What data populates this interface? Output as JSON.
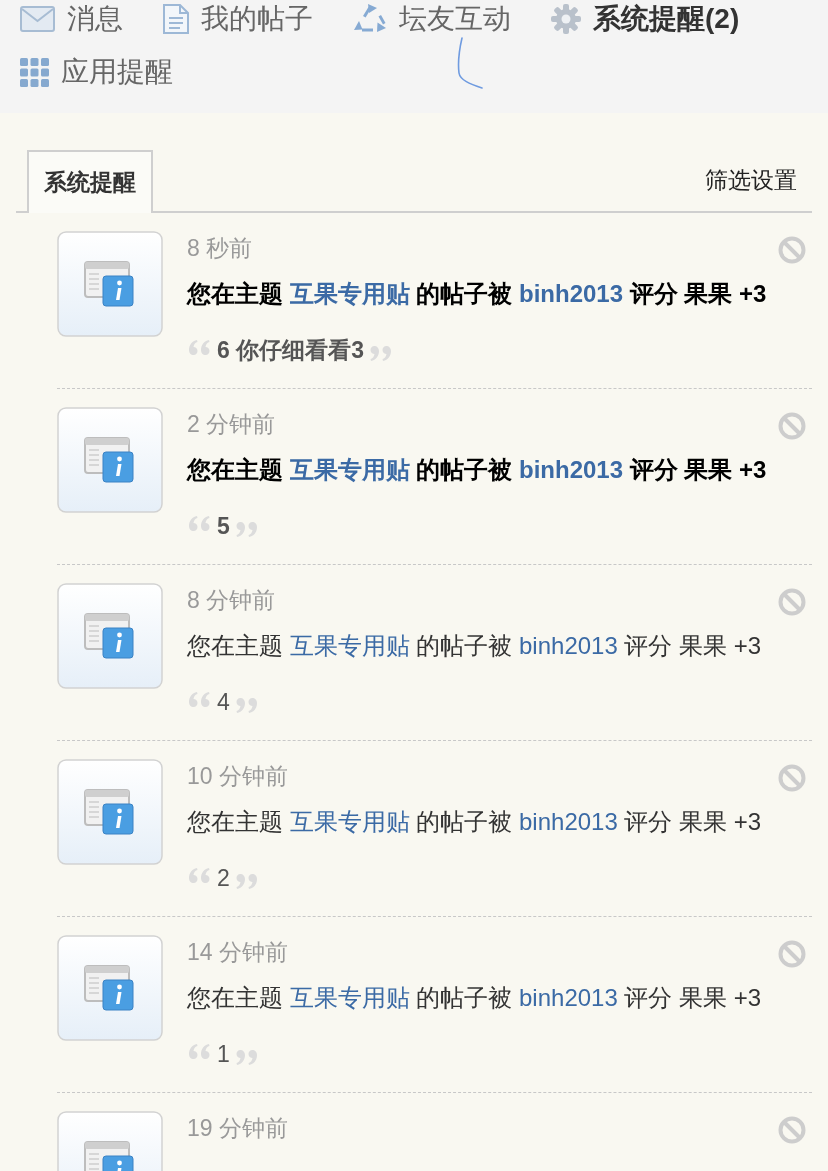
{
  "nav": {
    "items": [
      {
        "label": "消息",
        "selected": false
      },
      {
        "label": "我的帖子",
        "selected": false
      },
      {
        "label": "坛友互动",
        "selected": false
      },
      {
        "label": "系统提醒(2)",
        "selected": true
      },
      {
        "label": "应用提醒",
        "selected": false
      }
    ]
  },
  "tabs": [
    {
      "label": "系统提醒",
      "selected": true
    }
  ],
  "filter_link": "筛选设置",
  "notifications": [
    {
      "time": "8 秒前",
      "unread": true,
      "message": [
        {
          "kind": "text",
          "text": "您在主题 "
        },
        {
          "kind": "link",
          "text": "互果专用贴"
        },
        {
          "kind": "text",
          "text": " 的帖子被 "
        },
        {
          "kind": "link",
          "text": "binh2013"
        },
        {
          "kind": "text",
          "text": " 评分 果果 +3"
        }
      ],
      "quote": "6 你仔细看看3"
    },
    {
      "time": "2 分钟前",
      "unread": true,
      "message": [
        {
          "kind": "text",
          "text": "您在主题 "
        },
        {
          "kind": "link",
          "text": "互果专用贴"
        },
        {
          "kind": "text",
          "text": " 的帖子被 "
        },
        {
          "kind": "link",
          "text": "binh2013"
        },
        {
          "kind": "text",
          "text": " 评分 果果 +3"
        }
      ],
      "quote": "5"
    },
    {
      "time": "8 分钟前",
      "unread": false,
      "message": [
        {
          "kind": "text",
          "text": "您在主题 "
        },
        {
          "kind": "link",
          "text": "互果专用贴"
        },
        {
          "kind": "text",
          "text": " 的帖子被 "
        },
        {
          "kind": "link",
          "text": "binh2013"
        },
        {
          "kind": "text",
          "text": " 评分 果果 +3"
        }
      ],
      "quote": "4"
    },
    {
      "time": "10 分钟前",
      "unread": false,
      "message": [
        {
          "kind": "text",
          "text": "您在主题 "
        },
        {
          "kind": "link",
          "text": "互果专用贴"
        },
        {
          "kind": "text",
          "text": " 的帖子被 "
        },
        {
          "kind": "link",
          "text": "binh2013"
        },
        {
          "kind": "text",
          "text": " 评分 果果 +3"
        }
      ],
      "quote": "2"
    },
    {
      "time": "14 分钟前",
      "unread": false,
      "message": [
        {
          "kind": "text",
          "text": "您在主题 "
        },
        {
          "kind": "link",
          "text": "互果专用贴"
        },
        {
          "kind": "text",
          "text": " 的帖子被 "
        },
        {
          "kind": "link",
          "text": "binh2013"
        },
        {
          "kind": "text",
          "text": " 评分 果果 +3"
        }
      ],
      "quote": "1"
    },
    {
      "time": "19 分钟前"
    }
  ]
}
